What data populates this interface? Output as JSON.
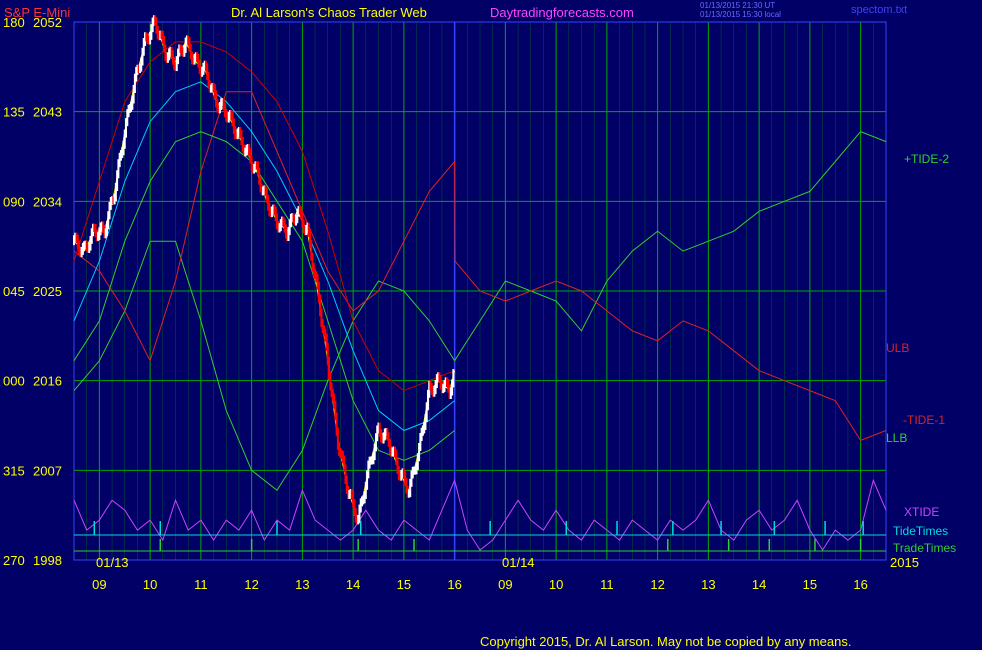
{
  "header": {
    "symbol": "S&P E-Mini",
    "title": "Dr. Al Larson's Chaos Trader Web",
    "site": "Daytradingforecasts.com",
    "stamp_line1": "01/13/2015 21:30 UT",
    "stamp_line2": "01/13/2015 15:30 local",
    "file": "spectom.txt"
  },
  "footer": {
    "copyright": "Copyright 2015, Dr. Al Larson. May not be copied by any means."
  },
  "colors": {
    "background": "#000066",
    "grid": "#00aa00",
    "axis_text": "#ffff00",
    "tide_plus": "#33cc33",
    "tide_minus": "#dd2222",
    "xtide": "#cc44ff",
    "tide_times": "#00dddd",
    "trade_times": "#33cc33",
    "price_up": "#ffffff",
    "price_down": "#ff0000",
    "envelope_upper": "#cc0000",
    "envelope_mid": "#00ccff",
    "envelope_inner": "#ffff00",
    "envelope_lower": "#33cc33"
  },
  "chart_data": {
    "type": "line",
    "title": "S&P E-Mini",
    "y_tick_labels": [
      {
        "angle": "180",
        "price": "2052"
      },
      {
        "angle": "135",
        "price": "2043"
      },
      {
        "angle": "090",
        "price": "2034"
      },
      {
        "angle": "045",
        "price": "2025"
      },
      {
        "angle": "000",
        "price": "2016"
      },
      {
        "angle": "315",
        "price": "2007"
      },
      {
        "angle": "270",
        "price": "1998"
      }
    ],
    "ylim": [
      1998,
      2052
    ],
    "x_tick_labels": [
      "09",
      "10",
      "11",
      "12",
      "13",
      "14",
      "15",
      "16",
      "09",
      "10",
      "11",
      "12",
      "13",
      "14",
      "15",
      "16"
    ],
    "xlim": [
      8.5,
      24.5
    ],
    "date_labels": [
      {
        "text": "01/13",
        "x": 8.5
      },
      {
        "text": "01/14",
        "x": 16.5
      }
    ],
    "year_label": "2015",
    "series_labels": [
      {
        "name": "+TIDE-2",
        "color": "#33cc33"
      },
      {
        "name": "ULB",
        "color": "#dd2222"
      },
      {
        "name": "-TIDE-1",
        "color": "#dd2222"
      },
      {
        "name": "LLB",
        "color": "#33cc33"
      },
      {
        "name": "XTIDE",
        "color": "#cc44ff"
      },
      {
        "name": "TideTimes",
        "color": "#00dddd"
      },
      {
        "name": "TradeTimes",
        "color": "#33cc33"
      }
    ],
    "price_series": {
      "name": "S&P E-Mini",
      "x": [
        8.5,
        8.7,
        8.9,
        9.1,
        9.3,
        9.5,
        9.7,
        9.9,
        10.1,
        10.3,
        10.5,
        10.7,
        10.9,
        11.1,
        11.3,
        11.5,
        11.7,
        11.9,
        12.1,
        12.3,
        12.5,
        12.7,
        12.9,
        13.1,
        13.3,
        13.5,
        13.7,
        13.9,
        14.1,
        14.3,
        14.5,
        14.7,
        14.9,
        15.1,
        15.3,
        15.5,
        15.7,
        15.9,
        16.0
      ],
      "y": [
        2030,
        2029,
        2031,
        2031,
        2035,
        2041,
        2046,
        2050,
        2052,
        2049,
        2048,
        2050,
        2048,
        2047,
        2044,
        2043,
        2041,
        2039,
        2037,
        2034,
        2032,
        2031,
        2033,
        2031,
        2025,
        2018,
        2010,
        2005,
        2002,
        2007,
        2011,
        2010,
        2007,
        2005,
        2009,
        2015,
        2016,
        2015,
        2017
      ]
    },
    "plus_tide_2": {
      "x": [
        8.5,
        9.0,
        9.5,
        10.0,
        10.5,
        11.0,
        11.5,
        12.0,
        12.5,
        13.0,
        13.5,
        14.0,
        14.5,
        15.0,
        15.5,
        16.0,
        16.5,
        17.0,
        17.5,
        18.0,
        18.5,
        19.0,
        19.5,
        20.0,
        20.5,
        21.0,
        21.5,
        22.0,
        22.5,
        23.0,
        23.5,
        24.0,
        24.5
      ],
      "y": [
        2015,
        2018,
        2023,
        2030,
        2030,
        2022,
        2013,
        2007,
        2005,
        2009,
        2016,
        2022,
        2026,
        2025,
        2022,
        2018,
        2022,
        2026,
        2025,
        2024,
        2021,
        2026,
        2029,
        2031,
        2029,
        2030,
        2031,
        2033,
        2034,
        2035,
        2038,
        2041,
        2040
      ]
    },
    "minus_tide_1": {
      "x": [
        8.5,
        9.0,
        9.5,
        10.0,
        10.5,
        11.0,
        11.5,
        12.0,
        12.5,
        13.0,
        13.5,
        14.0,
        14.5,
        15.0,
        15.5,
        16.0,
        16.01,
        16.5,
        17.0,
        17.5,
        18.0,
        18.5,
        19.0,
        19.5,
        20.0,
        20.5,
        21.0,
        21.5,
        22.0,
        22.5,
        23.0,
        23.5,
        24.0,
        24.5
      ],
      "y": [
        2029,
        2027,
        2023,
        2018,
        2026,
        2037,
        2045,
        2045,
        2039,
        2033,
        2027,
        2023,
        2025,
        2030,
        2035,
        2038,
        2028,
        2025,
        2024,
        2025,
        2026,
        2025,
        2023,
        2021,
        2020,
        2022,
        2021,
        2019,
        2017,
        2016,
        2015,
        2014,
        2010,
        2011
      ]
    },
    "envelope_upper": {
      "x": [
        8.5,
        9.0,
        9.5,
        10.0,
        10.5,
        11.0,
        11.5,
        12.0,
        12.5,
        13.0,
        13.5,
        14.0,
        14.5,
        15.0,
        15.5,
        16.0
      ],
      "y": [
        2028,
        2036,
        2044,
        2048,
        2050,
        2050,
        2049,
        2047,
        2044,
        2039,
        2031,
        2022,
        2017,
        2015,
        2016,
        2017
      ]
    },
    "envelope_mid": {
      "x": [
        8.5,
        9.0,
        9.5,
        10.0,
        10.5,
        11.0,
        11.5,
        12.0,
        12.5,
        13.0,
        13.5,
        14.0,
        14.5,
        15.0,
        15.5,
        16.0
      ],
      "y": [
        2022,
        2028,
        2036,
        2042,
        2045,
        2046,
        2044,
        2041,
        2037,
        2032,
        2026,
        2019,
        2013,
        2011,
        2012,
        2014
      ]
    },
    "envelope_lower": {
      "x": [
        8.5,
        9.0,
        9.5,
        10.0,
        10.5,
        11.0,
        11.5,
        12.0,
        12.5,
        13.0,
        13.5,
        14.0,
        14.5,
        15.0,
        15.5,
        16.0
      ],
      "y": [
        2018,
        2022,
        2030,
        2036,
        2040,
        2041,
        2040,
        2038,
        2034,
        2030,
        2022,
        2014,
        2009,
        2008,
        2009,
        2011
      ]
    },
    "xtide": {
      "x": [
        8.5,
        8.75,
        9.0,
        9.25,
        9.5,
        9.75,
        10.0,
        10.25,
        10.5,
        10.75,
        11.0,
        11.25,
        11.5,
        11.75,
        12.0,
        12.25,
        12.5,
        12.75,
        13.0,
        13.25,
        13.5,
        13.75,
        14.0,
        14.25,
        14.5,
        14.75,
        15.0,
        15.25,
        15.5,
        15.75,
        16.0,
        16.25,
        16.5,
        16.75,
        17.0,
        17.25,
        17.5,
        17.75,
        18.0,
        18.25,
        18.5,
        18.75,
        19.0,
        19.25,
        19.5,
        19.75,
        20.0,
        20.25,
        20.5,
        20.75,
        21.0,
        21.25,
        21.5,
        21.75,
        22.0,
        22.25,
        22.5,
        22.75,
        23.0,
        23.25,
        23.5,
        23.75,
        24.0,
        24.25,
        24.5
      ],
      "y": [
        2004,
        2001,
        2002,
        2004,
        2003,
        2001,
        2002,
        2000,
        2004,
        2001,
        2002,
        2000,
        2002,
        2001,
        2003,
        2000,
        2002,
        2001,
        2005,
        2002,
        2001,
        2000,
        2001,
        2003,
        2001,
        2000,
        2002,
        2001,
        2000,
        2003,
        2006,
        2001,
        1999,
        2000,
        2002,
        2004,
        2002,
        2001,
        2003,
        2001,
        2000,
        2002,
        2001,
        2000,
        2002,
        2001,
        2000,
        2002,
        2001,
        2002,
        2004,
        2001,
        2000,
        2002,
        2003,
        2001,
        2002,
        2004,
        2001,
        1999,
        2001,
        2000,
        2001,
        2006,
        2003
      ]
    },
    "tide_times_x": [
      8.9,
      10.2,
      12.5,
      14.15,
      16.7,
      18.2,
      19.2,
      20.3,
      21.25,
      22.3,
      23.3,
      24.05
    ],
    "trade_times_x": [
      10.2,
      12.0,
      14.1,
      15.2,
      20.2,
      21.4,
      22.2,
      23.1,
      24.0
    ]
  }
}
